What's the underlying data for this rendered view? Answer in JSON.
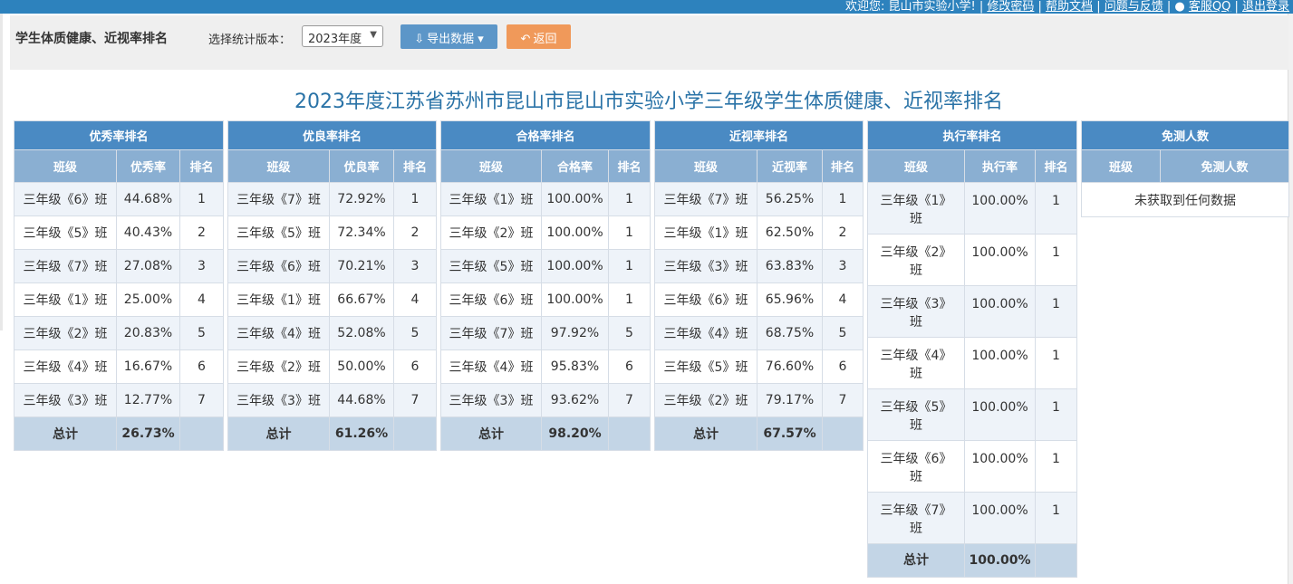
{
  "topbar": {
    "welcome": "欢迎您: 昆山市实验小学!",
    "links": [
      "修改密码",
      "帮助文档",
      "问题与反馈",
      "客服QQ",
      "退出登录"
    ]
  },
  "toolbar": {
    "page_title": "学生体质健康、近视率排名",
    "version_label": "选择统计版本：",
    "version_selected": "2023年度",
    "export_label": "导出数据",
    "back_label": "返回"
  },
  "main_title": "2023年度江苏省苏州市昆山市昆山市实验小学三年级学生体质健康、近视率排名",
  "tables": {
    "excellent": {
      "caption": "优秀率排名",
      "headers": [
        "班级",
        "优秀率",
        "排名"
      ],
      "rows": [
        [
          "三年级《6》班",
          "44.68%",
          "1"
        ],
        [
          "三年级《5》班",
          "40.43%",
          "2"
        ],
        [
          "三年级《7》班",
          "27.08%",
          "3"
        ],
        [
          "三年级《1》班",
          "25.00%",
          "4"
        ],
        [
          "三年级《2》班",
          "20.83%",
          "5"
        ],
        [
          "三年级《4》班",
          "16.67%",
          "6"
        ],
        [
          "三年级《3》班",
          "12.77%",
          "7"
        ]
      ],
      "total_label": "总计",
      "total_value": "26.73%"
    },
    "good": {
      "caption": "优良率排名",
      "headers": [
        "班级",
        "优良率",
        "排名"
      ],
      "rows": [
        [
          "三年级《7》班",
          "72.92%",
          "1"
        ],
        [
          "三年级《5》班",
          "72.34%",
          "2"
        ],
        [
          "三年级《6》班",
          "70.21%",
          "3"
        ],
        [
          "三年级《1》班",
          "66.67%",
          "4"
        ],
        [
          "三年级《4》班",
          "52.08%",
          "5"
        ],
        [
          "三年级《2》班",
          "50.00%",
          "6"
        ],
        [
          "三年级《3》班",
          "44.68%",
          "7"
        ]
      ],
      "total_label": "总计",
      "total_value": "61.26%"
    },
    "pass": {
      "caption": "合格率排名",
      "headers": [
        "班级",
        "合格率",
        "排名"
      ],
      "rows": [
        [
          "三年级《1》班",
          "100.00%",
          "1"
        ],
        [
          "三年级《2》班",
          "100.00%",
          "1"
        ],
        [
          "三年级《5》班",
          "100.00%",
          "1"
        ],
        [
          "三年级《6》班",
          "100.00%",
          "1"
        ],
        [
          "三年级《7》班",
          "97.92%",
          "5"
        ],
        [
          "三年级《4》班",
          "95.83%",
          "6"
        ],
        [
          "三年级《3》班",
          "93.62%",
          "7"
        ]
      ],
      "total_label": "总计",
      "total_value": "98.20%"
    },
    "myopia": {
      "caption": "近视率排名",
      "headers": [
        "班级",
        "近视率",
        "排名"
      ],
      "rows": [
        [
          "三年级《7》班",
          "56.25%",
          "1"
        ],
        [
          "三年级《1》班",
          "62.50%",
          "2"
        ],
        [
          "三年级《3》班",
          "63.83%",
          "3"
        ],
        [
          "三年级《6》班",
          "65.96%",
          "4"
        ],
        [
          "三年级《4》班",
          "68.75%",
          "5"
        ],
        [
          "三年级《5》班",
          "76.60%",
          "6"
        ],
        [
          "三年级《2》班",
          "79.17%",
          "7"
        ]
      ],
      "total_label": "总计",
      "total_value": "67.57%"
    },
    "execution": {
      "caption": "执行率排名",
      "headers": [
        "班级",
        "执行率",
        "排名"
      ],
      "rows": [
        [
          "三年级《1》班",
          "100.00%",
          "1"
        ],
        [
          "三年级《2》班",
          "100.00%",
          "1"
        ],
        [
          "三年级《3》班",
          "100.00%",
          "1"
        ],
        [
          "三年级《4》班",
          "100.00%",
          "1"
        ],
        [
          "三年级《5》班",
          "100.00%",
          "1"
        ],
        [
          "三年级《6》班",
          "100.00%",
          "1"
        ],
        [
          "三年级《7》班",
          "100.00%",
          "1"
        ]
      ],
      "total_label": "总计",
      "total_value": "100.00%"
    },
    "exempt": {
      "caption": "免测人数",
      "headers": [
        "班级",
        "免测人数"
      ],
      "empty_text": "未获取到任何数据"
    }
  },
  "icons": {
    "export": "download-icon",
    "back": "undo-icon",
    "qq": "qq-penguin-icon"
  },
  "colors": {
    "header_blue": "#4a8ac3",
    "subheader_blue": "#8aafd2",
    "title_blue": "#2a73a7",
    "export_button": "#5c96c8",
    "back_button": "#f0995a"
  }
}
